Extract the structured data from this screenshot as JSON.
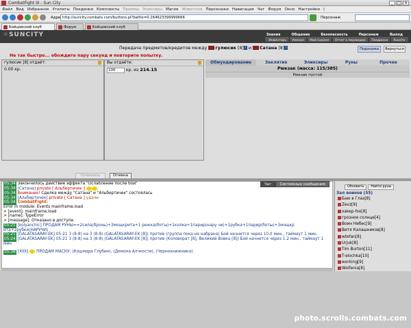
{
  "window": {
    "title": "CombatFight III - Sun City"
  },
  "menu": [
    "Файл",
    "Вид",
    "Избранное",
    "Утилиты",
    "Поединки",
    "Комплекты",
    "Приемы",
    "Эликсиры",
    "Магия",
    "Животное",
    "Персонажи",
    "Навигация",
    "Чат",
    "Форум",
    "Окно",
    "Настройки",
    "("
  ],
  "address": {
    "label": "Адрес",
    "value": "http://suncity.combats.com/buttons.pl?battle=0.164623399999666",
    "search_label": "Персонаж"
  },
  "tabs": [
    "Бойцовский клуб",
    "Форум",
    "Бойцовский клуб"
  ],
  "game_nav": {
    "top": [
      "Знания",
      "Общение",
      "Безопасность",
      "Персонаж",
      "Выход"
    ],
    "sub": [
      "Инвентарь",
      "Умения",
      "Мой Скролл",
      "Отчет о переводах",
      "Поединки",
      "Анкета"
    ]
  },
  "transfer": {
    "title_prefix": "Передача предметов/кредитов между",
    "user1": "гулюсик",
    "user1_level": "[8]",
    "and": "и",
    "user2": "Сатана",
    "user2_level": "[8]",
    "hint_label": "Подсказка",
    "return_label": "Вернуться",
    "error": "Не так быстро... обождите пару секунд и повторите попытку.",
    "left_head": "гулюсик [8]  отдаёт:",
    "left_amount": "0.00 кр.",
    "right_head": "Вы отдаёте:",
    "right_amount_value": "100",
    "right_amount_of": "кр. из",
    "right_amount_total": "214.15",
    "cancel_label": "Отменить",
    "close_label": "Отмена"
  },
  "inventory": {
    "tabs": [
      "Обмундирование",
      "Заклятия",
      "Эликсиры",
      "Руны",
      "Прочее"
    ],
    "weight": "Рюкзак (масса: 115/385)",
    "empty": "Рюкзак пустой"
  },
  "chat_tabs": [
    "Чат",
    "Системные сообщения"
  ],
  "chat": [
    {
      "time": "05:34",
      "nick": "",
      "kind": "sys",
      "text": "Закончилось действие эффекта \"Ослабление после бой\""
    },
    {
      "time": "05:34",
      "nick": "[Сатана]",
      "kind": "private",
      "target": "private [ Альбертичек ]",
      "text": ""
    },
    {
      "time": "05:34",
      "nick": "",
      "kind": "warn",
      "label": "Внимание!",
      "text": "Сделка между \"Сатана\" и \"Альбертичек\" состоялась"
    },
    {
      "time": "05:34",
      "nick": "[Альбертичек]",
      "kind": "private",
      "target": "private [ Сатана ]",
      "text": "удачи"
    },
    {
      "time": "05:34",
      "nick": "",
      "kind": "sysname",
      "label": "CombatFight:",
      "text": ""
    },
    {
      "kind": "plain",
      "text": "Error in module: Events mainframe.load"
    },
    {
      "kind": "plain",
      "text": "> [event]: mainframe.load"
    },
    {
      "kind": "plain",
      "text": "> [name]: TypeError"
    },
    {
      "kind": "plain",
      "text": "> [message]: Отказано в доступе."
    },
    {
      "time": "05:21",
      "nick": "[kolyanchic]",
      "kind": "blue",
      "text": "ПРОДАМ РУНЫ==2сила(бронь)+3мощкрита+1 режка(боты)+1колка+1парир(нару чи)+1рубка+1парир(боты)+3мощкр ита+2рубки(НАРУЧИ)"
    },
    {
      "time": "05:21",
      "nick": "[GALATASARAY-EK]",
      "kind": "battle",
      "text": "05:21 3 (8-8) на 3 (8-8) (GALATASARAY-EK [8]) против (группа пока не набрана) Бой начнется через 10.0 мин., таймаут 1 мин."
    },
    {
      "time": "05:24",
      "nick": "[GALATASARAY-EK]",
      "kind": "battle",
      "text": "05:21 3 (8-8) на 3 (8-8) (GALATASARAY-EK [8]) против (Коловорат [8], Великий Вовка [8]) Бой начнется через 1.2 мин., таймаут 1 мин."
    },
    {
      "time": "05:38",
      "nick": "[XIIX]",
      "kind": "blue",
      "text": "ПРОДАМ МАСКУ: (Кошмара Глубин), (Демона Алчности), (Чернокнижника)"
    }
  ],
  "users": {
    "btn_refresh": "Обновить",
    "btn_find": "Найти руны",
    "title": "Зал воинов (55)",
    "list": [
      "Баю в Глаз[8]",
      "Zevz[9]",
      "xakep-fox[8]",
      "грозное солнце[4]",
      "Воин Небес[9]",
      "Витя Калашников[8]",
      "wtefan[8]",
      "Urjuk[8]",
      "Tim Burton[11]",
      "T-elochka[10]",
      "working[9]",
      "Wolfenia[8]"
    ]
  },
  "watermark": "photo.scrolls.combats.com"
}
